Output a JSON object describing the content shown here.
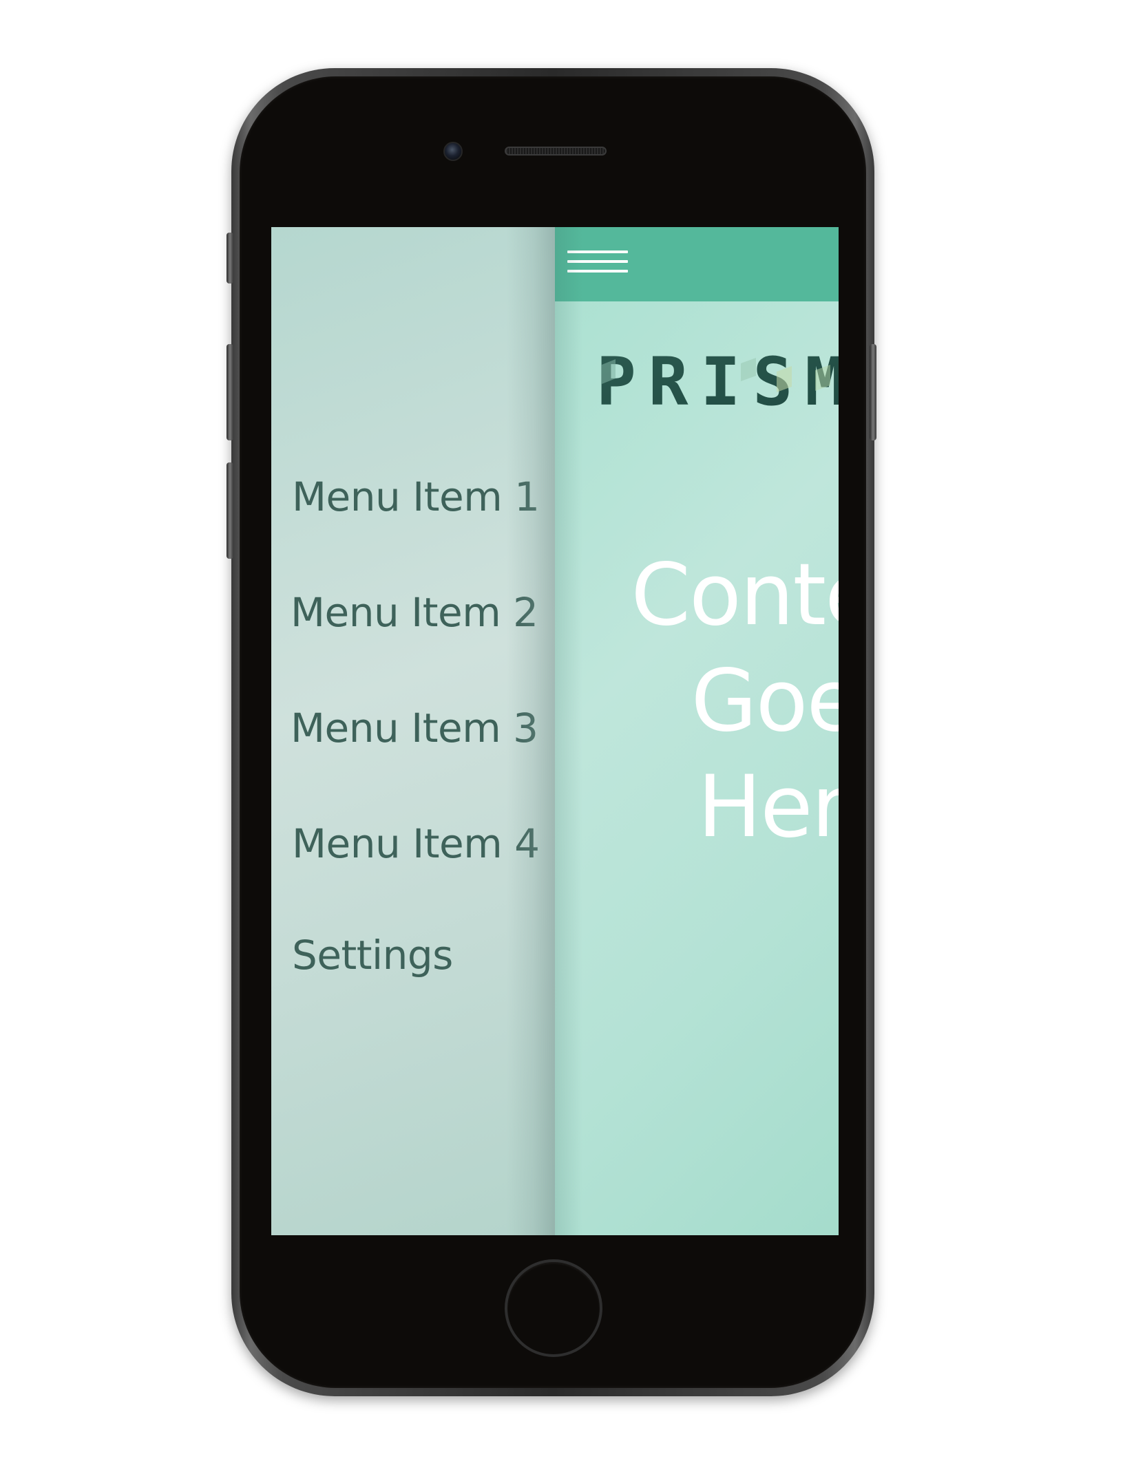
{
  "drawer": {
    "items": [
      {
        "label": "Menu Item 1"
      },
      {
        "label": "Menu Item 2"
      },
      {
        "label": "Menu Item 3"
      },
      {
        "label": "Menu Item 4"
      },
      {
        "label": "Settings"
      }
    ]
  },
  "header": {
    "menu_icon": "hamburger-icon",
    "color": "#54b89b"
  },
  "logo": {
    "text": "PRISM"
  },
  "content": {
    "lines": [
      "Content",
      "Goes",
      "Here"
    ]
  },
  "colors": {
    "drawer_text": "#3e625a",
    "main_background": "#b4e2d5",
    "logo_dark": "#2f5f55"
  }
}
